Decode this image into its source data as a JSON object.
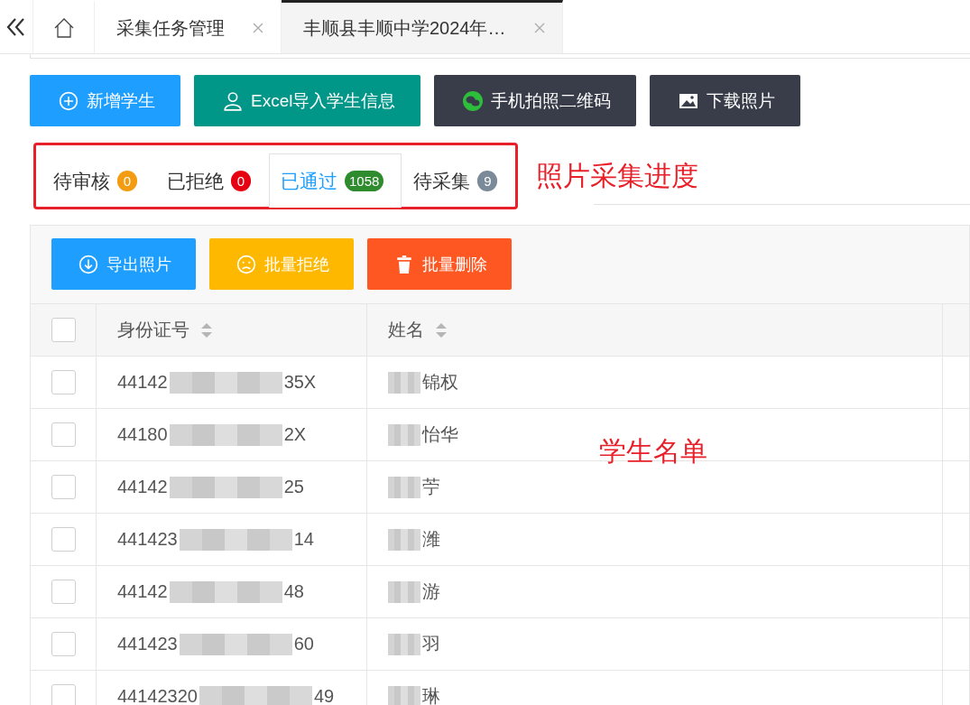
{
  "page_tabs": [
    {
      "kind": "home",
      "selected": false
    },
    {
      "kind": "page",
      "label": "采集任务管理",
      "selected": false
    },
    {
      "kind": "page",
      "label": "丰顺县丰顺中学2024年…",
      "selected": true
    }
  ],
  "action_buttons": [
    {
      "kind": "add",
      "label": "新增学生"
    },
    {
      "kind": "import",
      "label": "Excel导入学生信息"
    },
    {
      "kind": "qrcode",
      "label": "手机拍照二维码"
    },
    {
      "kind": "download",
      "label": "下载照片"
    }
  ],
  "status_tabs": [
    {
      "label": "待审核",
      "count": "0",
      "color": "#f39c12",
      "selected": false
    },
    {
      "label": "已拒绝",
      "count": "0",
      "color": "#e60012",
      "selected": false
    },
    {
      "label": "已通过",
      "count": "1058",
      "color": "#2e8b2e",
      "selected": true
    },
    {
      "label": "待采集",
      "count": "9",
      "color": "#7a8a99",
      "selected": false
    }
  ],
  "annotations": [
    {
      "text": "照片采集进度"
    },
    {
      "text": "学生名单"
    }
  ],
  "table": {
    "toolbar": [
      {
        "kind": "export",
        "label": "导出照片"
      },
      {
        "kind": "reject",
        "label": "批量拒绝"
      },
      {
        "kind": "delete",
        "label": "批量删除"
      }
    ],
    "header_checked": false,
    "columns": [
      {
        "label": "身份证号"
      },
      {
        "label": "姓名"
      }
    ],
    "rows": [
      {
        "checked": false,
        "id_head": "44142",
        "id_tail": "35X",
        "name_tail": "锦权"
      },
      {
        "checked": false,
        "id_head": "44180",
        "id_tail": "2X",
        "name_tail": "怡华"
      },
      {
        "checked": false,
        "id_head": "44142",
        "id_tail": "25",
        "name_tail": "苧"
      },
      {
        "checked": false,
        "id_head": "441423",
        "id_tail": "14",
        "name_tail": "潍"
      },
      {
        "checked": false,
        "id_head": "44142",
        "id_tail": "48",
        "name_tail": "游"
      },
      {
        "checked": false,
        "id_head": "441423",
        "id_tail": "60",
        "name_tail": "羽"
      },
      {
        "checked": false,
        "id_head": "44142320",
        "id_tail": "49",
        "name_tail": "琳"
      }
    ]
  }
}
